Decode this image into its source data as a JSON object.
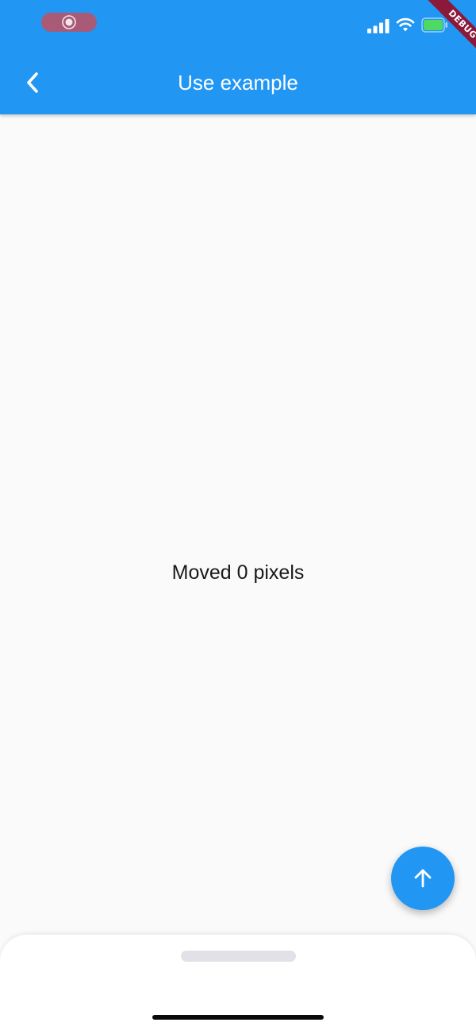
{
  "app_bar": {
    "title": "Use example",
    "back_icon": "chevron-left-icon",
    "background_color": "#2196f3"
  },
  "status_bar": {
    "icons": [
      "screen-record-icon",
      "signal-icon",
      "wifi-icon",
      "battery-icon"
    ]
  },
  "debug_banner": {
    "label": "DEBUG",
    "color": "#8b1a3a"
  },
  "body": {
    "moved_text": "Moved 0 pixels"
  },
  "fab": {
    "icon": "arrow-up-icon",
    "color": "#2196f3"
  },
  "bottom_sheet": {
    "handle": "drag-handle"
  }
}
